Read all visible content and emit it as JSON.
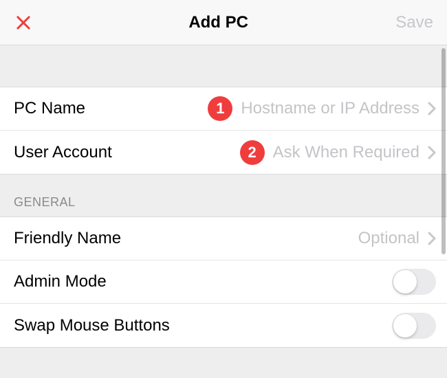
{
  "navbar": {
    "title": "Add PC",
    "close_icon": "close-icon",
    "save_label": "Save"
  },
  "section1": {
    "rows": [
      {
        "label": "PC Name",
        "value": "Hostname or IP Address",
        "badge": "1"
      },
      {
        "label": "User Account",
        "value": "Ask When Required",
        "badge": "2"
      }
    ]
  },
  "section2": {
    "header": "GENERAL",
    "rows": [
      {
        "label": "Friendly Name",
        "value": "Optional",
        "type": "disclosure"
      },
      {
        "label": "Admin Mode",
        "type": "toggle",
        "on": false
      },
      {
        "label": "Swap Mouse Buttons",
        "type": "toggle",
        "on": false
      }
    ]
  },
  "colors": {
    "accent": "#ef3d3d",
    "placeholder": "#c4c4c8"
  }
}
